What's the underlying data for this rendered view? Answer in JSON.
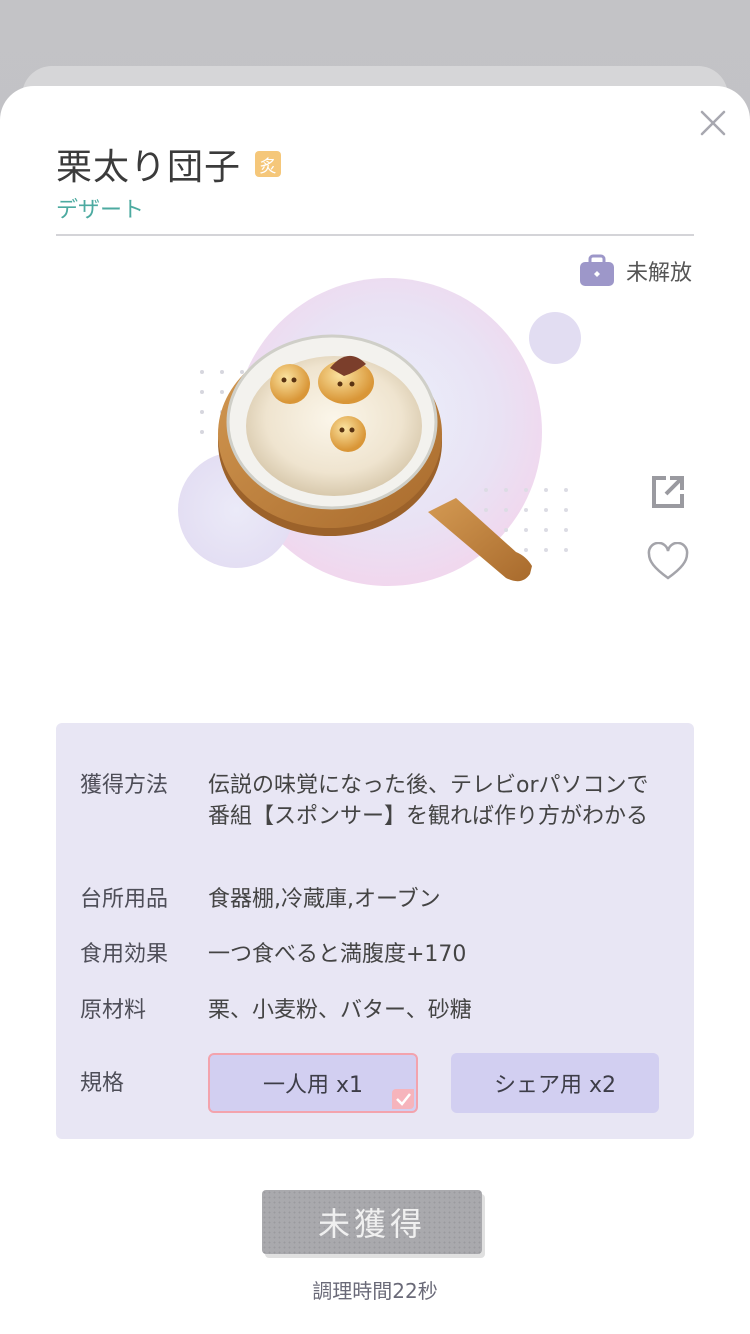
{
  "item": {
    "name": "栗太り団子",
    "badge": "炙",
    "category": "デザート",
    "lock_status": "未解放"
  },
  "details": [
    {
      "key": "獲得方法",
      "value": "伝説の味覚になった後、テレビorパソコンで番組【スポンサー】を観れば作り方がわかる"
    },
    {
      "key": "台所用品",
      "value": "食器棚,冷蔵庫,オーブン"
    },
    {
      "key": "食用効果",
      "value": "一つ食べると満腹度+170"
    },
    {
      "key": "原材料",
      "value": "栗、小麦粉、バター、砂糖"
    }
  ],
  "spec": {
    "label": "規格",
    "options": [
      {
        "label": "一人用 x1",
        "selected": true
      },
      {
        "label": "シェア用 x2",
        "selected": false
      }
    ]
  },
  "action": {
    "obtain_label": "未獲得",
    "cook_time": "調理時間22秒"
  },
  "colors": {
    "accent_teal": "#4caaa0",
    "panel_bg": "#e8e6f4",
    "spec_bg": "#d2cff1",
    "selected_border": "#f3a3ad"
  }
}
